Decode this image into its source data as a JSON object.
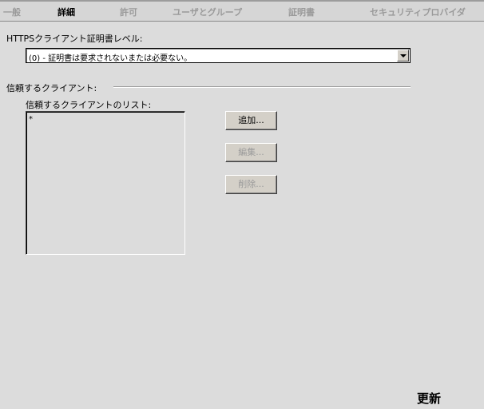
{
  "tabs": [
    {
      "label": "一般",
      "active": false
    },
    {
      "label": "詳細",
      "active": true
    },
    {
      "label": "許可",
      "active": false
    },
    {
      "label": "ユーザとグループ",
      "active": false
    },
    {
      "label": "証明書",
      "active": false
    },
    {
      "label": "セキュリティプロバイダ",
      "active": false
    }
  ],
  "https_level": {
    "label": "HTTPSクライアント証明書レベル:",
    "selected": "(0) - 証明書は要求されないまたは必要ない。"
  },
  "trusted_clients": {
    "section_label": "信頼するクライアント:",
    "list_label": "信頼するクライアントのリスト:",
    "items": [
      "*"
    ]
  },
  "buttons": {
    "add": "追加...",
    "edit": "編集...",
    "delete": "削除..."
  },
  "footer": {
    "update_label": "更新"
  }
}
